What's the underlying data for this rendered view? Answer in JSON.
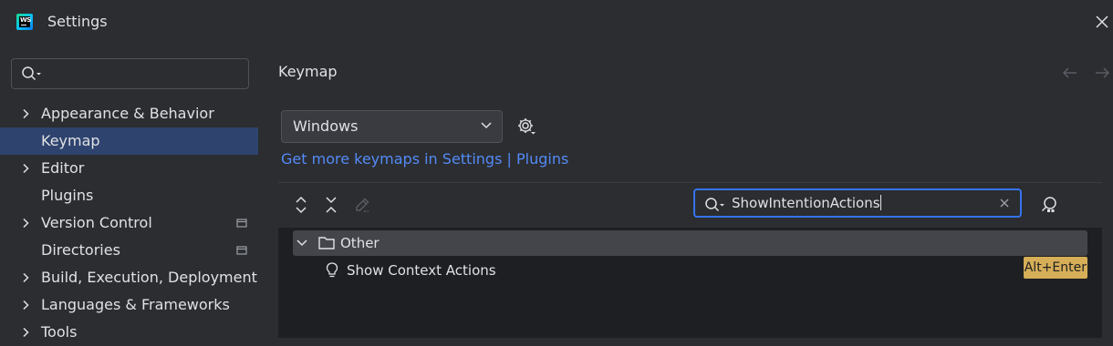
{
  "window": {
    "title": "Settings",
    "logo_icon": "webstorm-logo-icon"
  },
  "sidebar": {
    "search_placeholder": "",
    "items": [
      {
        "label": "Appearance & Behavior",
        "expandable": true,
        "project_icon": false,
        "selected": false
      },
      {
        "label": "Keymap",
        "expandable": false,
        "project_icon": false,
        "selected": true
      },
      {
        "label": "Editor",
        "expandable": true,
        "project_icon": false,
        "selected": false
      },
      {
        "label": "Plugins",
        "expandable": false,
        "project_icon": false,
        "selected": false
      },
      {
        "label": "Version Control",
        "expandable": true,
        "project_icon": true,
        "selected": false
      },
      {
        "label": "Directories",
        "expandable": false,
        "project_icon": true,
        "selected": false
      },
      {
        "label": "Build, Execution, Deployment",
        "expandable": true,
        "project_icon": false,
        "selected": false
      },
      {
        "label": "Languages & Frameworks",
        "expandable": true,
        "project_icon": false,
        "selected": false
      },
      {
        "label": "Tools",
        "expandable": true,
        "project_icon": false,
        "selected": false
      }
    ]
  },
  "main": {
    "title": "Keymap",
    "keymap_select": {
      "value": "Windows"
    },
    "links": {
      "settings_link": "Get more keymaps in Settings",
      "separator": "|",
      "plugins_link": "Plugins"
    },
    "filter": {
      "value": "ShowIntentionActions"
    },
    "tree": {
      "group": {
        "label": "Other",
        "expanded": true
      },
      "action": {
        "label": "Show Context Actions",
        "shortcut": "Alt+Enter"
      }
    }
  },
  "colors": {
    "background": "#2b2d30",
    "selection": "#2e436e",
    "accent": "#3574f0",
    "link": "#548af7",
    "shortcut_badge": "#d6ae58"
  }
}
